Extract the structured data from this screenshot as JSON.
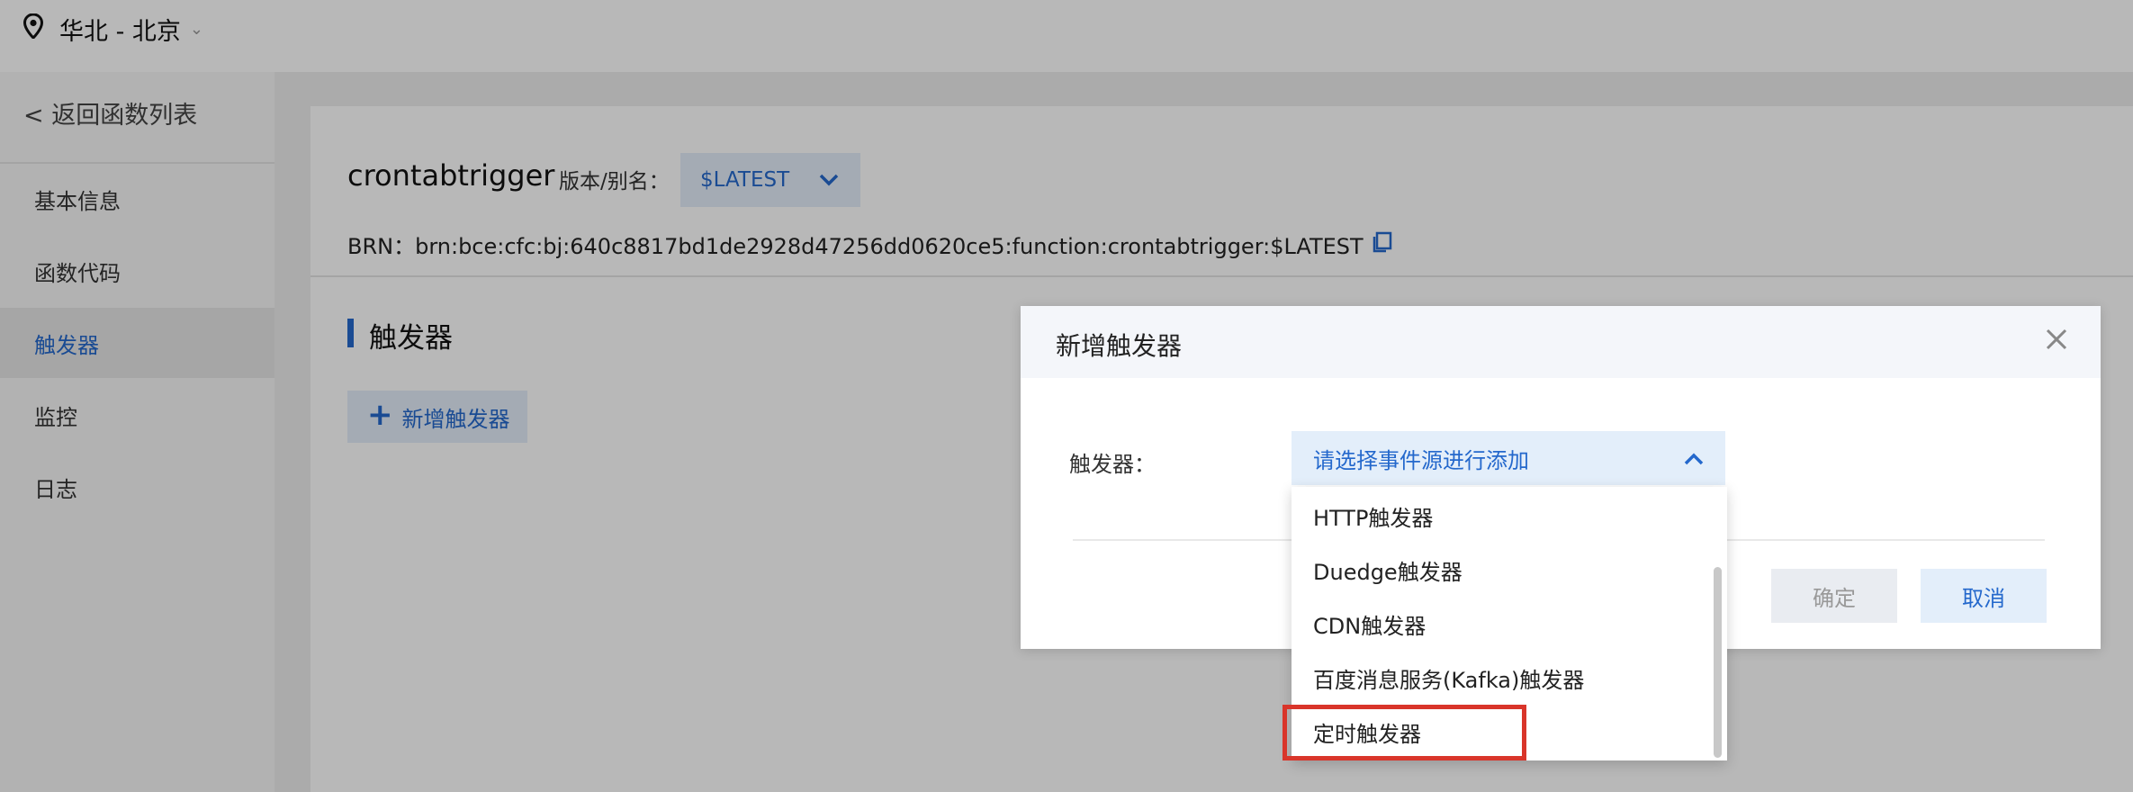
{
  "topbar": {
    "region": "华北 - 北京",
    "icons": {
      "location": "map-pin-icon",
      "caret": "chevron-down-icon"
    }
  },
  "sidebar": {
    "back_label": "< 返回函数列表",
    "items": [
      {
        "label": "基本信息"
      },
      {
        "label": "函数代码"
      },
      {
        "label": "触发器",
        "active": true
      },
      {
        "label": "监控"
      },
      {
        "label": "日志"
      }
    ]
  },
  "function": {
    "name": "crontabtrigger",
    "version_label": "版本/别名：",
    "version_value": "$LATEST",
    "brn": "BRN：brn:bce:cfc:bj:640c8817bd1de2928d47256dd0620ce5:function:crontabtrigger:$LATEST"
  },
  "section": {
    "title": "触发器",
    "add_button": "新增触发器"
  },
  "modal": {
    "title": "新增触发器",
    "trigger_label": "触发器：",
    "select_placeholder": "请选择事件源进行添加",
    "ok": "确定",
    "cancel": "取消",
    "options": [
      "HTTP触发器",
      "Duedge触发器",
      "CDN触发器",
      "百度消息服务(Kafka)触发器",
      "定时触发器"
    ],
    "highlighted_option": "定时触发器"
  },
  "colors": {
    "accent": "#2468cc",
    "highlight_border": "#d9352a",
    "select_bg": "#e3eefa"
  }
}
